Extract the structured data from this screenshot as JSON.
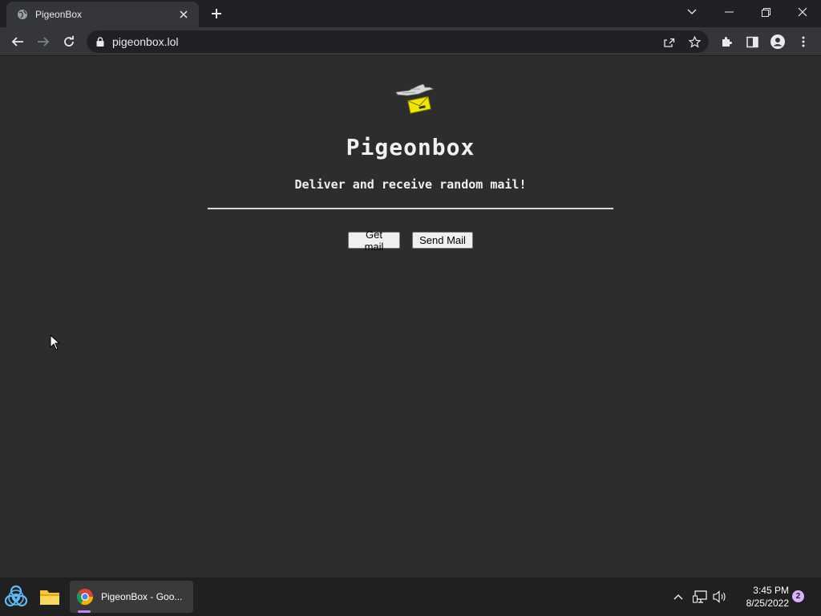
{
  "browser": {
    "tab_title": "PigeonBox",
    "url": "pigeonbox.lol"
  },
  "page": {
    "title": "Pigeonbox",
    "tagline": "Deliver and receive random mail!",
    "buttons": {
      "get_mail": "Get mail",
      "send_mail": "Send Mail"
    },
    "colors": {
      "background": "#2d2d2d",
      "envelope": "#f2e600"
    }
  },
  "taskbar": {
    "chrome_window_label": "PigeonBox - Goo...",
    "time": "3:45 PM",
    "date": "8/25/2022",
    "notification_count": "2"
  }
}
